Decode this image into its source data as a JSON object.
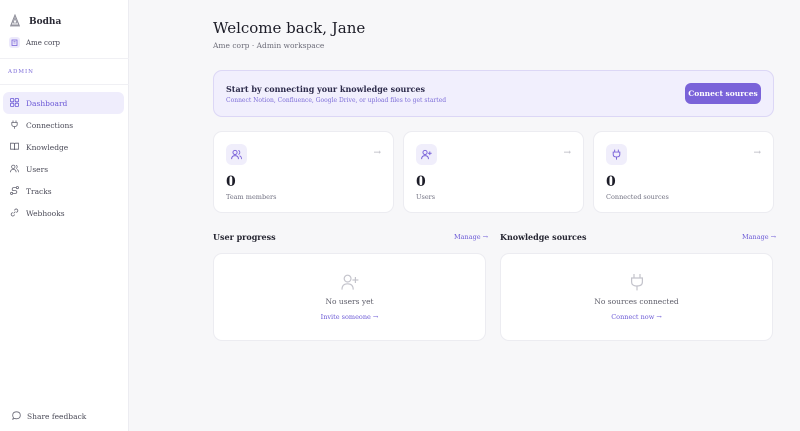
{
  "sidebar": {
    "brand": "Bodha",
    "org": "Ame corp",
    "section": "ADMIN",
    "items": [
      {
        "label": "Dashboard",
        "icon": "dashboard-icon"
      },
      {
        "label": "Connections",
        "icon": "plug-icon"
      },
      {
        "label": "Knowledge",
        "icon": "book-icon"
      },
      {
        "label": "Users",
        "icon": "users-icon"
      },
      {
        "label": "Tracks",
        "icon": "route-icon"
      },
      {
        "label": "Webhooks",
        "icon": "link-icon"
      }
    ],
    "feedback": "Share feedback"
  },
  "header": {
    "title": "Welcome back, Jane",
    "subtitle": "Ame corp · Admin workspace"
  },
  "banner": {
    "title": "Start by connecting your knowledge sources",
    "subtitle": "Connect Notion, Confluence, Google Drive, or upload files to get started",
    "button": "Connect sources"
  },
  "stats": [
    {
      "value": "0",
      "label": "Team members",
      "icon": "users-icon"
    },
    {
      "value": "0",
      "label": "Users",
      "icon": "user-plus-icon"
    },
    {
      "value": "0",
      "label": "Connected sources",
      "icon": "plug-icon"
    }
  ],
  "arrow_glyph": "→",
  "progress": {
    "title": "User progress",
    "manage": "Manage →",
    "empty_text": "No users yet",
    "action": "Invite someone →"
  },
  "sources": {
    "title": "Knowledge sources",
    "manage": "Manage →",
    "empty_text": "No sources connected",
    "action": "Connect now →"
  },
  "colors": {
    "accent": "#7a63d9",
    "accent_light": "#efedfc",
    "background": "#f7f7f9"
  }
}
